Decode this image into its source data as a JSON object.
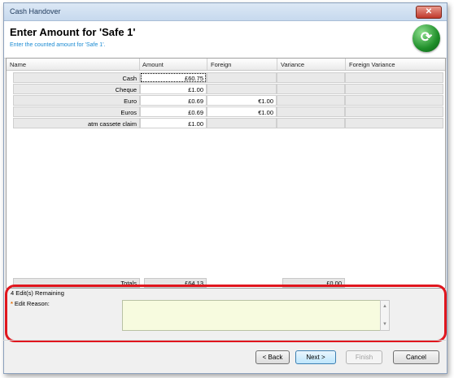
{
  "window": {
    "title": "Cash Handover",
    "close_label": "✕"
  },
  "header": {
    "title": "Enter Amount for 'Safe 1'",
    "subtitle": "Enter the counted amount for 'Safe 1'."
  },
  "table": {
    "columns": [
      "Name",
      "Amount",
      "Foreign",
      "Variance",
      "Foreign Variance"
    ],
    "rows": [
      {
        "name": "Cash",
        "amount": "£60.75",
        "foreign": "",
        "variance": "",
        "foreign_variance": ""
      },
      {
        "name": "Cheque",
        "amount": "£1.00",
        "foreign": "",
        "variance": "",
        "foreign_variance": ""
      },
      {
        "name": "Euro",
        "amount": "£0.69",
        "foreign": "€1.00",
        "variance": "",
        "foreign_variance": ""
      },
      {
        "name": "Euros",
        "amount": "£0.69",
        "foreign": "€1.00",
        "variance": "",
        "foreign_variance": ""
      },
      {
        "name": "atm cassete claim",
        "amount": "£1.00",
        "foreign": "",
        "variance": "",
        "foreign_variance": ""
      }
    ],
    "totals": {
      "label": "Totals",
      "amount": "£64.13",
      "variance": "£0.00"
    }
  },
  "edit": {
    "remaining": "4 Edit(s) Remaining",
    "required_marker": "*",
    "reason_label": "Edit Reason:",
    "reason_value": ""
  },
  "buttons": {
    "back": "< Back",
    "next": "Next >",
    "finish": "Finish",
    "cancel": "Cancel"
  },
  "colors": {
    "reason_bg": "#f7fbdf",
    "highlight": "#e0161e",
    "subtitle": "#1b8bd3"
  },
  "icons": {
    "logo": "refresh-handover-icon"
  }
}
